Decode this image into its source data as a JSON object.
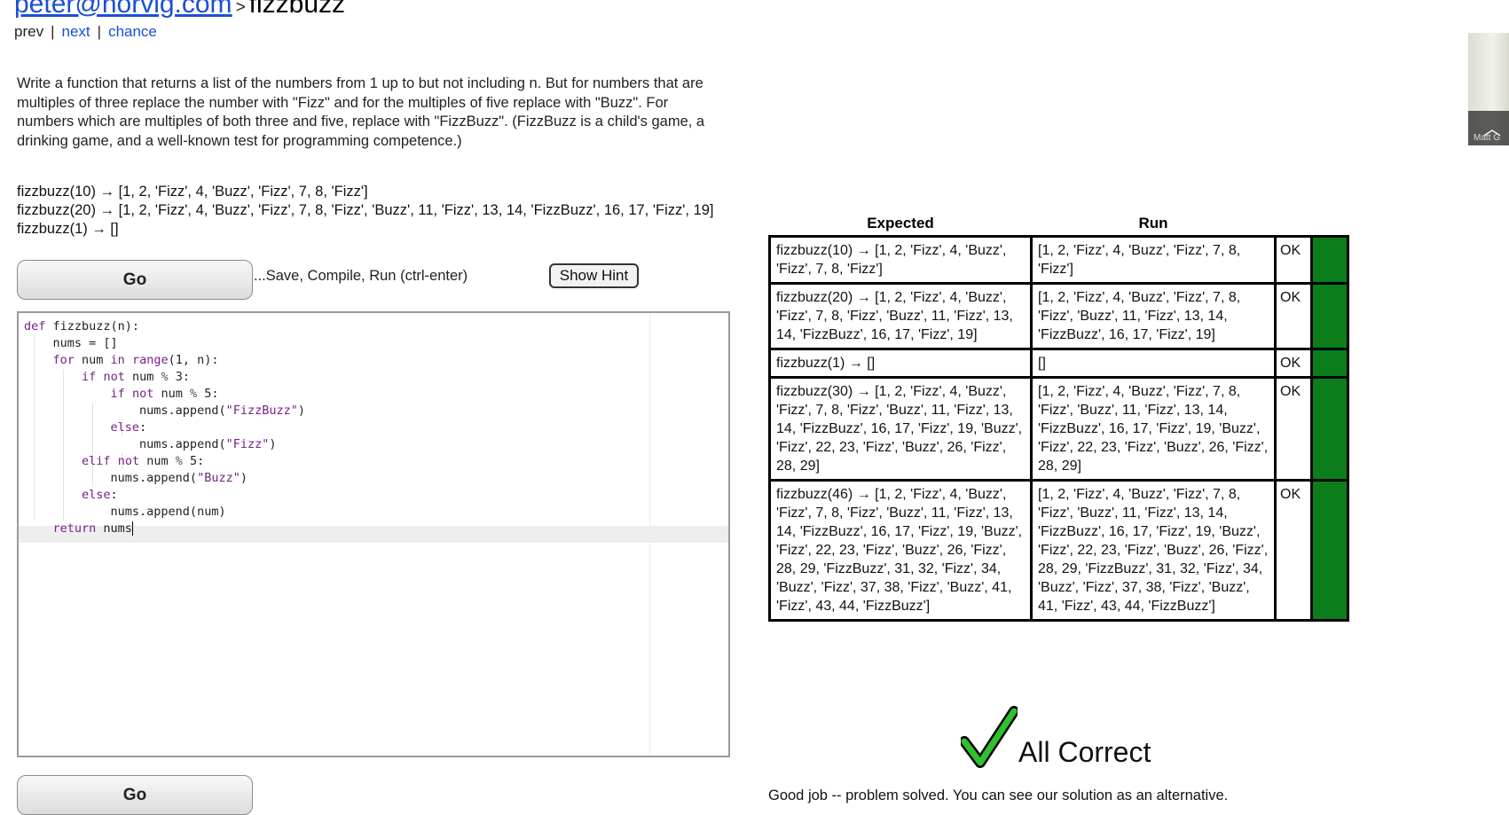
{
  "header": {
    "site_link": "peter@norvig.com",
    "separator": ">",
    "problem_name": "fizzbuzz"
  },
  "nav": {
    "prev": "prev",
    "sep": "|",
    "next": "next",
    "chance": "chance"
  },
  "description": "Write a function that returns a list of the numbers from 1 up to but not including n. But for numbers that are multiples of three replace the number with \"Fizz\" and for the multiples of five replace with \"Buzz\". For numbers which are multiples of both three and five, replace with \"FizzBuzz\". (FizzBuzz is a child's game, a drinking game, and a well-known test for programming competence.)",
  "examples": [
    "fizzbuzz(10) → [1, 2, 'Fizz', 4, 'Buzz', 'Fizz', 7, 8, 'Fizz']",
    "fizzbuzz(20) → [1, 2, 'Fizz', 4, 'Buzz', 'Fizz', 7, 8, 'Fizz', 'Buzz', 11, 'Fizz', 13, 14, 'FizzBuzz', 16, 17, 'Fizz', 19]",
    "fizzbuzz(1) → []"
  ],
  "controls": {
    "go_label": "Go",
    "save_text": "...Save, Compile, Run (ctrl-enter)",
    "hint_label": "Show Hint"
  },
  "editor": {
    "lines": [
      "def fizzbuzz(n):",
      "    nums = []",
      "    for num in range(1, n):",
      "        if not num % 3:",
      "            if not num % 5:",
      "                nums.append(\"FizzBuzz\")",
      "            else:",
      "                nums.append(\"Fizz\")",
      "        elif not num % 5:",
      "            nums.append(\"Buzz\")",
      "        else:",
      "            nums.append(num)",
      "    return nums"
    ]
  },
  "results": {
    "headers": {
      "expected": "Expected",
      "run": "Run"
    },
    "rows": [
      {
        "expected": "fizzbuzz(10) → [1, 2, 'Fizz', 4, 'Buzz', 'Fizz', 7, 8, 'Fizz']",
        "run": "[1, 2, 'Fizz', 4, 'Buzz', 'Fizz', 7, 8, 'Fizz']",
        "status": "OK"
      },
      {
        "expected": "fizzbuzz(20) → [1, 2, 'Fizz', 4, 'Buzz', 'Fizz', 7, 8, 'Fizz', 'Buzz', 11, 'Fizz', 13, 14, 'FizzBuzz', 16, 17, 'Fizz', 19]",
        "run": "[1, 2, 'Fizz', 4, 'Buzz', 'Fizz', 7, 8, 'Fizz', 'Buzz', 11, 'Fizz', 13, 14, 'FizzBuzz', 16, 17, 'Fizz', 19]",
        "status": "OK"
      },
      {
        "expected": "fizzbuzz(1) → []",
        "run": "[]",
        "status": "OK"
      },
      {
        "expected": "fizzbuzz(30) → [1, 2, 'Fizz', 4, 'Buzz', 'Fizz', 7, 8, 'Fizz', 'Buzz', 11, 'Fizz', 13, 14, 'FizzBuzz', 16, 17, 'Fizz', 19, 'Buzz', 'Fizz', 22, 23, 'Fizz', 'Buzz', 26, 'Fizz', 28, 29]",
        "run": "[1, 2, 'Fizz', 4, 'Buzz', 'Fizz', 7, 8, 'Fizz', 'Buzz', 11, 'Fizz', 13, 14, 'FizzBuzz', 16, 17, 'Fizz', 19, 'Buzz', 'Fizz', 22, 23, 'Fizz', 'Buzz', 26, 'Fizz', 28, 29]",
        "status": "OK"
      },
      {
        "expected": "fizzbuzz(46) → [1, 2, 'Fizz', 4, 'Buzz', 'Fizz', 7, 8, 'Fizz', 'Buzz', 11, 'Fizz', 13, 14, 'FizzBuzz', 16, 17, 'Fizz', 19, 'Buzz', 'Fizz', 22, 23, 'Fizz', 'Buzz', 26, 'Fizz', 28, 29, 'FizzBuzz', 31, 32, 'Fizz', 34, 'Buzz', 'Fizz', 37, 38, 'Fizz', 'Buzz', 41, 'Fizz', 43, 44, 'FizzBuzz']",
        "run": "[1, 2, 'Fizz', 4, 'Buzz', 'Fizz', 7, 8, 'Fizz', 'Buzz', 11, 'Fizz', 13, 14, 'FizzBuzz', 16, 17, 'Fizz', 19, 'Buzz', 'Fizz', 22, 23, 'Fizz', 'Buzz', 26, 'Fizz', 28, 29, 'FizzBuzz', 31, 32, 'Fizz', 34, 'Buzz', 'Fizz', 37, 38, 'Fizz', 'Buzz', 41, 'Fizz', 43, 44, 'FizzBuzz']",
        "status": "OK"
      }
    ],
    "pass_color": "#0b7d1a"
  },
  "feedback": {
    "check_icon": "green-checkmark-icon",
    "all_correct": "All Correct",
    "good_job": "Good job -- problem solved. You can see our solution as an alternative."
  },
  "thumbnail": {
    "caption": "Matt G"
  }
}
